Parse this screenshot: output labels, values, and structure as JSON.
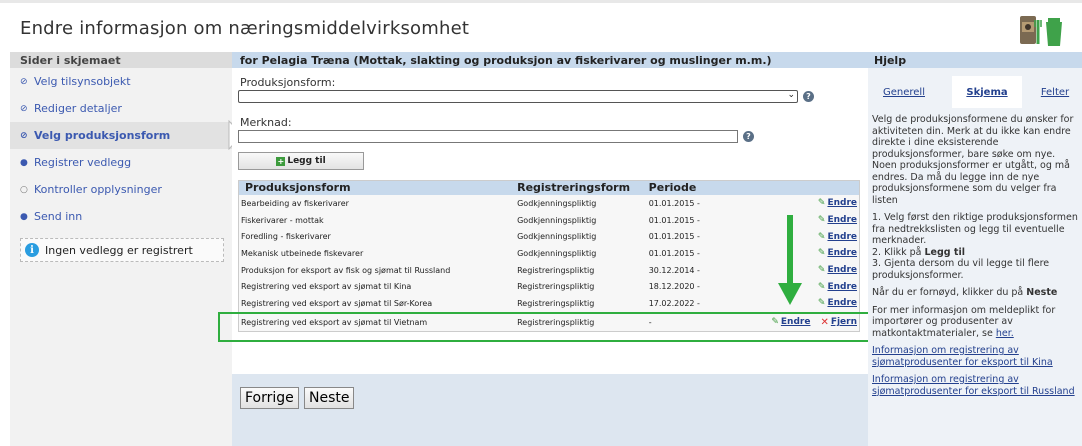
{
  "page_title": "Endre informasjon om næringsmiddelvirksomhet",
  "left": {
    "heading": "Sider i skjemaet",
    "items": [
      {
        "label": "Velg tilsynsobjekt"
      },
      {
        "label": "Rediger detaljer"
      },
      {
        "label": "Velg produksjonsform"
      },
      {
        "label": "Registrer vedlegg"
      },
      {
        "label": "Kontroller opplysninger"
      },
      {
        "label": "Send inn"
      }
    ],
    "info_text": "Ingen vedlegg er registrert"
  },
  "main": {
    "heading": "for Pelagia Træna (Mottak, slakting og produksjon av fiskerivarer og muslinger m.m.)",
    "produksjonsform_label": "Produksjonsform:",
    "produksjonsform_value": "",
    "merknad_label": "Merknad:",
    "merknad_value": "",
    "add_button": "Legg til",
    "table": {
      "headers": [
        "Produksjonsform",
        "Registreringsform",
        "Periode"
      ],
      "rows": [
        {
          "form": "Bearbeiding av fiskerivarer",
          "reg": "Godkjenningspliktig",
          "period": "01.01.2015 -",
          "edit": "Endre"
        },
        {
          "form": "Fiskerivarer - mottak",
          "reg": "Godkjenningspliktig",
          "period": "01.01.2015 -",
          "edit": "Endre"
        },
        {
          "form": "Foredling - fiskerivarer",
          "reg": "Godkjenningspliktig",
          "period": "01.01.2015 -",
          "edit": "Endre"
        },
        {
          "form": "Mekanisk utbeinede fiskevarer",
          "reg": "Godkjenningspliktig",
          "period": "01.01.2015 -",
          "edit": "Endre"
        },
        {
          "form": "Produksjon for eksport av fisk og sjømat til Russland",
          "reg": "Registreringspliktig",
          "period": "30.12.2014 -",
          "edit": "Endre"
        },
        {
          "form": "Registrering ved eksport av sjømat til Kina",
          "reg": "Registreringspliktig",
          "period": "18.12.2020 -",
          "edit": "Endre"
        },
        {
          "form": "Registrering ved eksport av sjømat til Sør-Korea",
          "reg": "Registreringspliktig",
          "period": "17.02.2022 -",
          "edit": "Endre"
        }
      ],
      "new_row": {
        "form": "Registrering ved eksport av sjømat til Vietnam",
        "reg": "Registreringspliktig",
        "period": "-",
        "edit": "Endre",
        "remove": "Fjern"
      }
    },
    "prev_button": "Forrige",
    "next_button": "Neste"
  },
  "help": {
    "heading": "Hjelp",
    "tabs": [
      "Generell",
      "Skjema",
      "Felter"
    ],
    "active_tab": "Skjema",
    "intro": "Velg de produksjonsformene du ønsker for aktiviteten din. Merk at du ikke kan endre direkte i dine eksisterende produksjonsformer, bare søke om nye. Noen produksjonsformer er utgått, og må endres. Da må du legge inn de nye produksjonsformene som du velger fra listen",
    "step1": "1. Velg først den riktige produksjonsformen fra nedtrekkslisten og legg til eventuelle merknader.",
    "step2_prefix": "2. Klikk på ",
    "step2_bold": "Legg til",
    "step3": "3. Gjenta dersom du vil legge til flere produksjonsformer.",
    "done_prefix": "Når du er fornøyd, klikker du på ",
    "done_bold": "Neste",
    "more_info": "For mer informasjon om meldeplikt for importører og produsenter av matkontaktmaterialer, se ",
    "more_info_link": "her.",
    "link1": "Informasjon om registrering av sjømatprodusenter for eksport til Kina",
    "link2": "Informasjon om registrering av sjømatprodusenter for eksport til Russland"
  },
  "colors": {
    "highlight": "#2fae3f",
    "link": "#23408e",
    "header_bg": "#c7d9ec"
  }
}
